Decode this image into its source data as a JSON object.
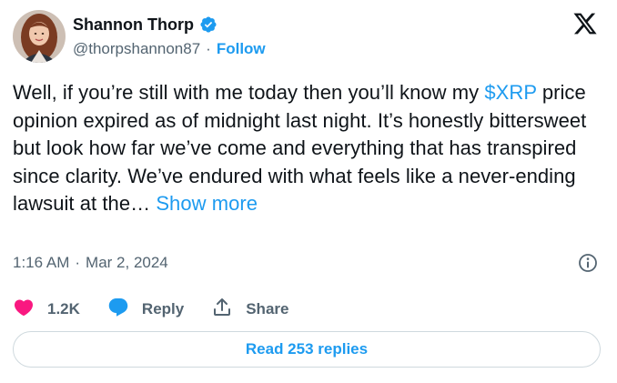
{
  "author": {
    "display_name": "Shannon Thorp",
    "handle": "@thorpshannon87",
    "separator": "·",
    "follow_label": "Follow",
    "verified": true
  },
  "tweet": {
    "text_before": "Well, if you’re still with me today then you’ll know my ",
    "cashtag": "$XRP",
    "text_after": " price opinion expired as of midnight last night. It’s honestly bittersweet but look how far we’ve come and everything that has transpired since clarity. We’ve endured with what feels like a never-ending lawsuit at the… ",
    "show_more_label": "Show more"
  },
  "meta": {
    "time": "1:16 AM",
    "separator": "·",
    "date": "Mar 2, 2024"
  },
  "actions": {
    "like_count": "1.2K",
    "reply_label": "Reply",
    "share_label": "Share"
  },
  "replies_button": {
    "label": "Read 253 replies"
  },
  "colors": {
    "accent": "#1d9bf0",
    "like": "#f91880",
    "text": "#0f1419",
    "muted": "#536471",
    "border": "#cfd9de"
  },
  "icons": {
    "brand": "x-logo-icon",
    "verified": "verified-badge-icon",
    "info": "info-icon",
    "like": "heart-icon",
    "reply": "speech-bubble-icon",
    "share": "share-upload-icon"
  }
}
